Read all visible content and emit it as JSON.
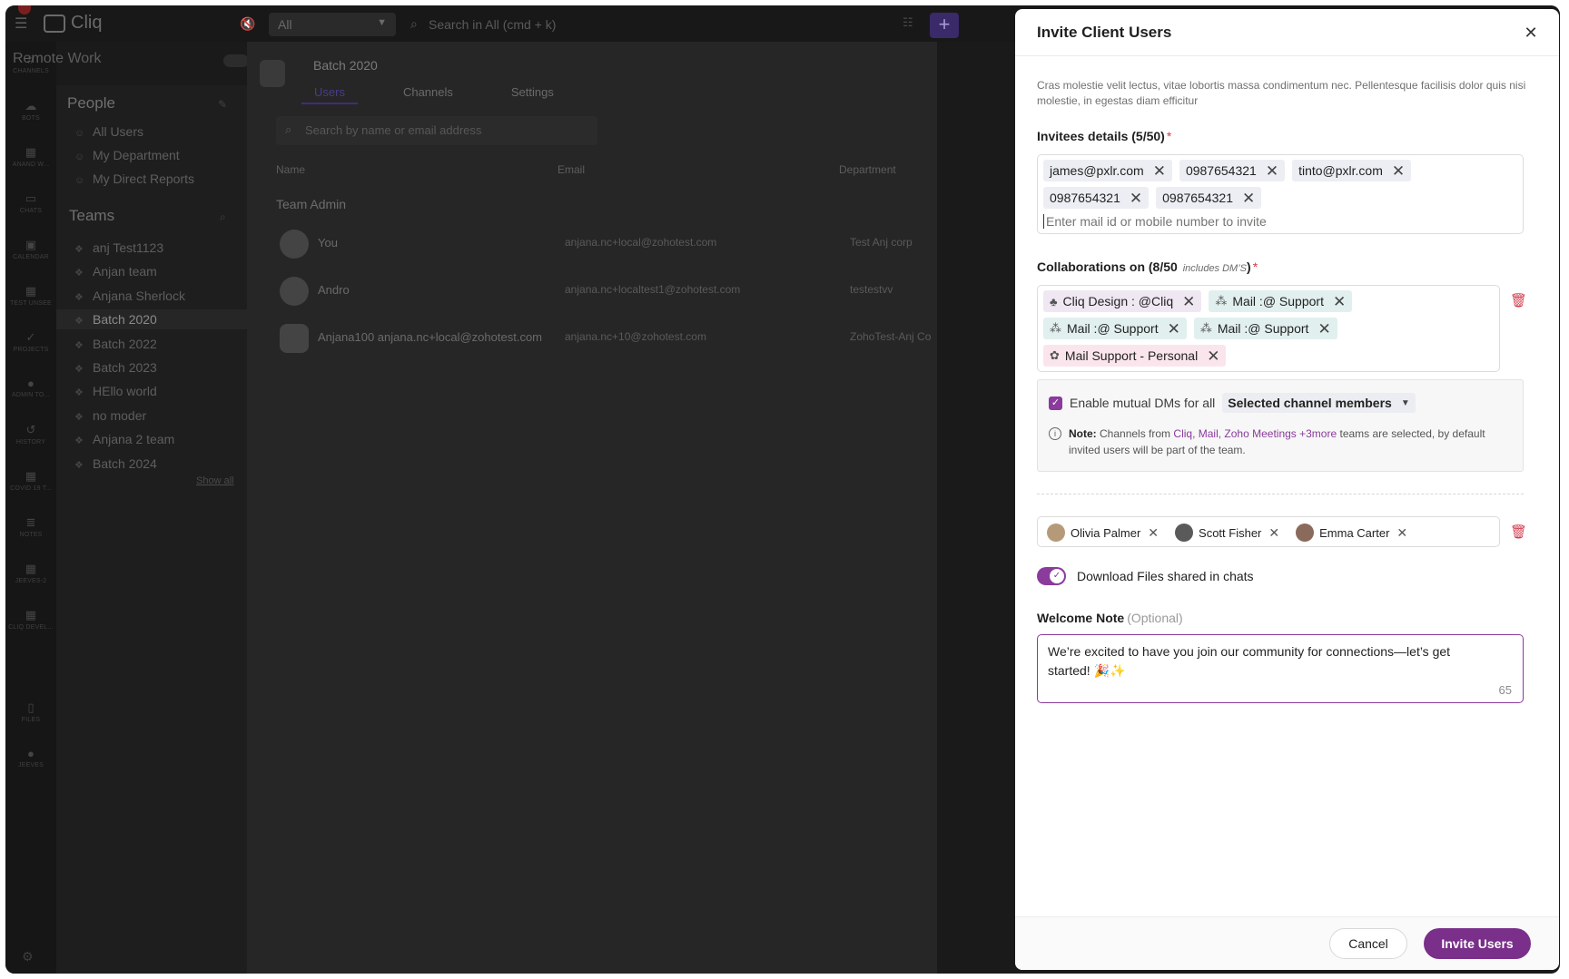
{
  "app": {
    "name": "Cliq",
    "org_name": "Remote Work",
    "scope": "All",
    "search_placeholder": "Search in All (cmd + k)"
  },
  "rail": [
    {
      "label": "CHANNELS",
      "icon": "hash-icon"
    },
    {
      "label": "BOTS",
      "icon": "bot-icon"
    },
    {
      "label": "ANAND W...",
      "icon": "grid-icon"
    },
    {
      "label": "CHATS",
      "icon": "chat-icon"
    },
    {
      "label": "CALENDAR",
      "icon": "calendar-icon"
    },
    {
      "label": "TEST UNSEE",
      "icon": "grid-icon"
    },
    {
      "label": "PROJECTS",
      "icon": "check-icon"
    },
    {
      "label": "ADMIN TO...",
      "icon": "bubble-icon"
    },
    {
      "label": "HISTORY",
      "icon": "history-icon"
    },
    {
      "label": "COVID 19 T...",
      "icon": "grid-icon"
    },
    {
      "label": "NOTES",
      "icon": "notes-icon"
    },
    {
      "label": "JEEVES-2",
      "icon": "grid-icon"
    },
    {
      "label": "CLIQ DEVEL...",
      "icon": "grid-icon"
    },
    {
      "label": "FILES",
      "icon": "file-icon"
    },
    {
      "label": "JEEVES",
      "icon": "bubble-icon"
    }
  ],
  "people": {
    "title": "People",
    "items": [
      "All Users",
      "My Department",
      "My Direct Reports"
    ]
  },
  "teams": {
    "title": "Teams",
    "items": [
      "anj Test1123",
      "Anjan team",
      "Anjana Sherlock",
      "Batch 2020",
      "Batch 2022",
      "Batch 2023",
      "HEllo world",
      "no moder",
      "Anjana 2 team",
      "Batch 2024"
    ],
    "show_all": "Show all"
  },
  "team_view": {
    "title": "Batch 2020",
    "tabs": [
      "Users",
      "Channels",
      "Settings"
    ],
    "search_placeholder": "Search by name or email address",
    "columns": [
      "Name",
      "Email",
      "Department"
    ],
    "group": "Team Admin",
    "rows": [
      {
        "name": "You",
        "email": "anjana.nc+local@zohotest.com",
        "department": "Test Anj corp"
      },
      {
        "name": "Andro",
        "email": "anjana.nc+localtest1@zohotest.com",
        "department": "testestvv"
      },
      {
        "name": "Anjana100 anjana.nc+local@zohotest.com",
        "email": "anjana.nc+10@zohotest.com",
        "department": "ZohoTest-Anj Co"
      }
    ]
  },
  "drawer": {
    "title": "Invite Client Users",
    "description": "Cras molestie velit lectus, vitae lobortis massa condimentum nec. Pellentesque facilisis dolor quis nisi molestie, in egestas diam efficitur",
    "invitees": {
      "label": "Invitees details (5/50)",
      "required": "*",
      "chips": [
        "james@pxlr.com",
        "0987654321",
        "tinto@pxlr.com",
        "0987654321",
        "0987654321"
      ],
      "placeholder": "Enter mail id or mobile number to invite"
    },
    "collaborations": {
      "label": "Collaborations on (8/50",
      "label_sub": "includes DM’S",
      "label_close": ")",
      "required": "*",
      "chips": [
        {
          "label": "Cliq Design : @Cliq",
          "style": "purple",
          "icon": "org-icon"
        },
        {
          "label": "Mail :@ Support",
          "style": "teal",
          "icon": "team-icon"
        },
        {
          "label": "Mail :@ Support",
          "style": "teal",
          "icon": "team-icon"
        },
        {
          "label": "Mail :@ Support",
          "style": "teal",
          "icon": "team-icon"
        },
        {
          "label": "Mail Support - Personal",
          "style": "pink",
          "icon": "personal-icon"
        }
      ]
    },
    "mutual_dm": {
      "label": "Enable mutual DMs for all",
      "selected": "Selected channel members",
      "note_label": "Note:",
      "note_pre": "Channels from",
      "note_links": "Cliq, Mail, Zoho Meetings +3more",
      "note_post": "teams are selected, by default invited users will be part of the team."
    },
    "users": [
      "Olivia Palmer",
      "Scott Fisher",
      "Emma Carter"
    ],
    "download_toggle": {
      "label": "Download Files shared in chats",
      "on": true
    },
    "welcome": {
      "label": "Welcome Note",
      "optional": "(Optional)",
      "text": "We’re excited to have you join our community for connections—let’s get started! 🎉✨",
      "count": "65"
    },
    "footer": {
      "cancel": "Cancel",
      "invite": "Invite Users"
    }
  },
  "colors": {
    "accent": "#8a3b9c",
    "invite_button": "#7a2f8a",
    "danger": "#d23c4d"
  }
}
